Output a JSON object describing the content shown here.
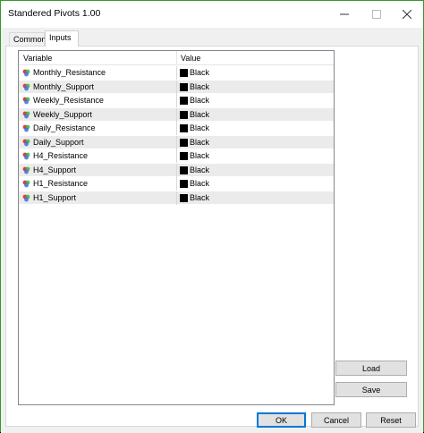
{
  "window": {
    "title": "Standered Pivots 1.00"
  },
  "tabs": [
    {
      "label": "Common"
    },
    {
      "label": "Inputs"
    }
  ],
  "grid": {
    "headers": {
      "variable": "Variable",
      "value": "Value"
    },
    "rows": [
      {
        "variable": "Monthly_Resistance",
        "value": "Black",
        "color": "#000000"
      },
      {
        "variable": "Monthly_Support",
        "value": "Black",
        "color": "#000000"
      },
      {
        "variable": "Weekly_Resistance",
        "value": "Black",
        "color": "#000000"
      },
      {
        "variable": "Weekly_Support",
        "value": "Black",
        "color": "#000000"
      },
      {
        "variable": "Daily_Resistance",
        "value": "Black",
        "color": "#000000"
      },
      {
        "variable": "Daily_Support",
        "value": "Black",
        "color": "#000000"
      },
      {
        "variable": "H4_Resistance",
        "value": "Black",
        "color": "#000000"
      },
      {
        "variable": "H4_Support",
        "value": "Black",
        "color": "#000000"
      },
      {
        "variable": "H1_Resistance",
        "value": "Black",
        "color": "#000000"
      },
      {
        "variable": "H1_Support",
        "value": "Black",
        "color": "#000000"
      }
    ]
  },
  "buttons": {
    "load": "Load",
    "save": "Save",
    "ok": "OK",
    "cancel": "Cancel",
    "reset": "Reset"
  },
  "icons": {
    "variable": "color-variable-icon",
    "minimize": "minimize-icon",
    "maximize": "maximize-icon",
    "close": "close-icon"
  }
}
